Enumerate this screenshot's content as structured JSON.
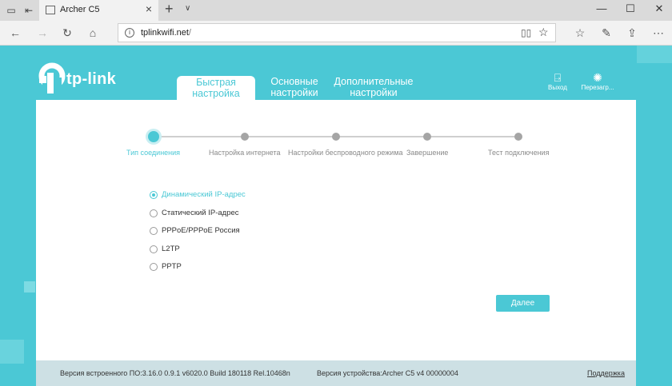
{
  "browser": {
    "tab_title": "Archer C5",
    "address": "tplinkwifi.net",
    "address_suffix": "/"
  },
  "router": {
    "logo": "tp-link",
    "tabs": [
      {
        "line1": "Быстрая",
        "line2": "настройка"
      },
      {
        "line1": "Основные",
        "line2": "настройки"
      },
      {
        "line1": "Дополнительные",
        "line2": "настройки"
      }
    ],
    "logout": "Выход",
    "reboot": "Перезагр...",
    "steps": [
      "Тип соединения",
      "Настройка интернета",
      "Настройки беспроводного режима",
      "Завершение",
      "Тест подключения"
    ],
    "options": [
      "Динамический IP-адрес",
      "Статический IP-адрес",
      "PPPoE/PPPoE Россия",
      "L2TP",
      "PPTP"
    ],
    "selected_option": "Динамический IP-адрес",
    "next_button": "Далее",
    "footer": {
      "firmware": "Версия встроенного ПО:3.16.0 0.9.1 v6020.0 Build 180118 Rel.10468n",
      "hardware": "Версия устройства:Archer C5 v4 00000004",
      "support": "Поддержка"
    }
  },
  "colors": {
    "accent": "#4bc8d5",
    "panel": "#ffffff",
    "footer": "#cde0e4"
  },
  "icons": [
    "tab-list-icon",
    "back-tab-icon",
    "favicon-icon",
    "close-tab-icon",
    "new-tab-icon",
    "tab-menu-icon",
    "minimize-icon",
    "maximize-icon",
    "close-window-icon",
    "back-icon",
    "forward-icon",
    "refresh-icon",
    "home-icon",
    "site-info-icon",
    "reading-view-icon",
    "favorite-star-icon",
    "favorites-icon",
    "pen-icon",
    "share-icon",
    "more-icon",
    "logout-icon",
    "reboot-icon"
  ]
}
